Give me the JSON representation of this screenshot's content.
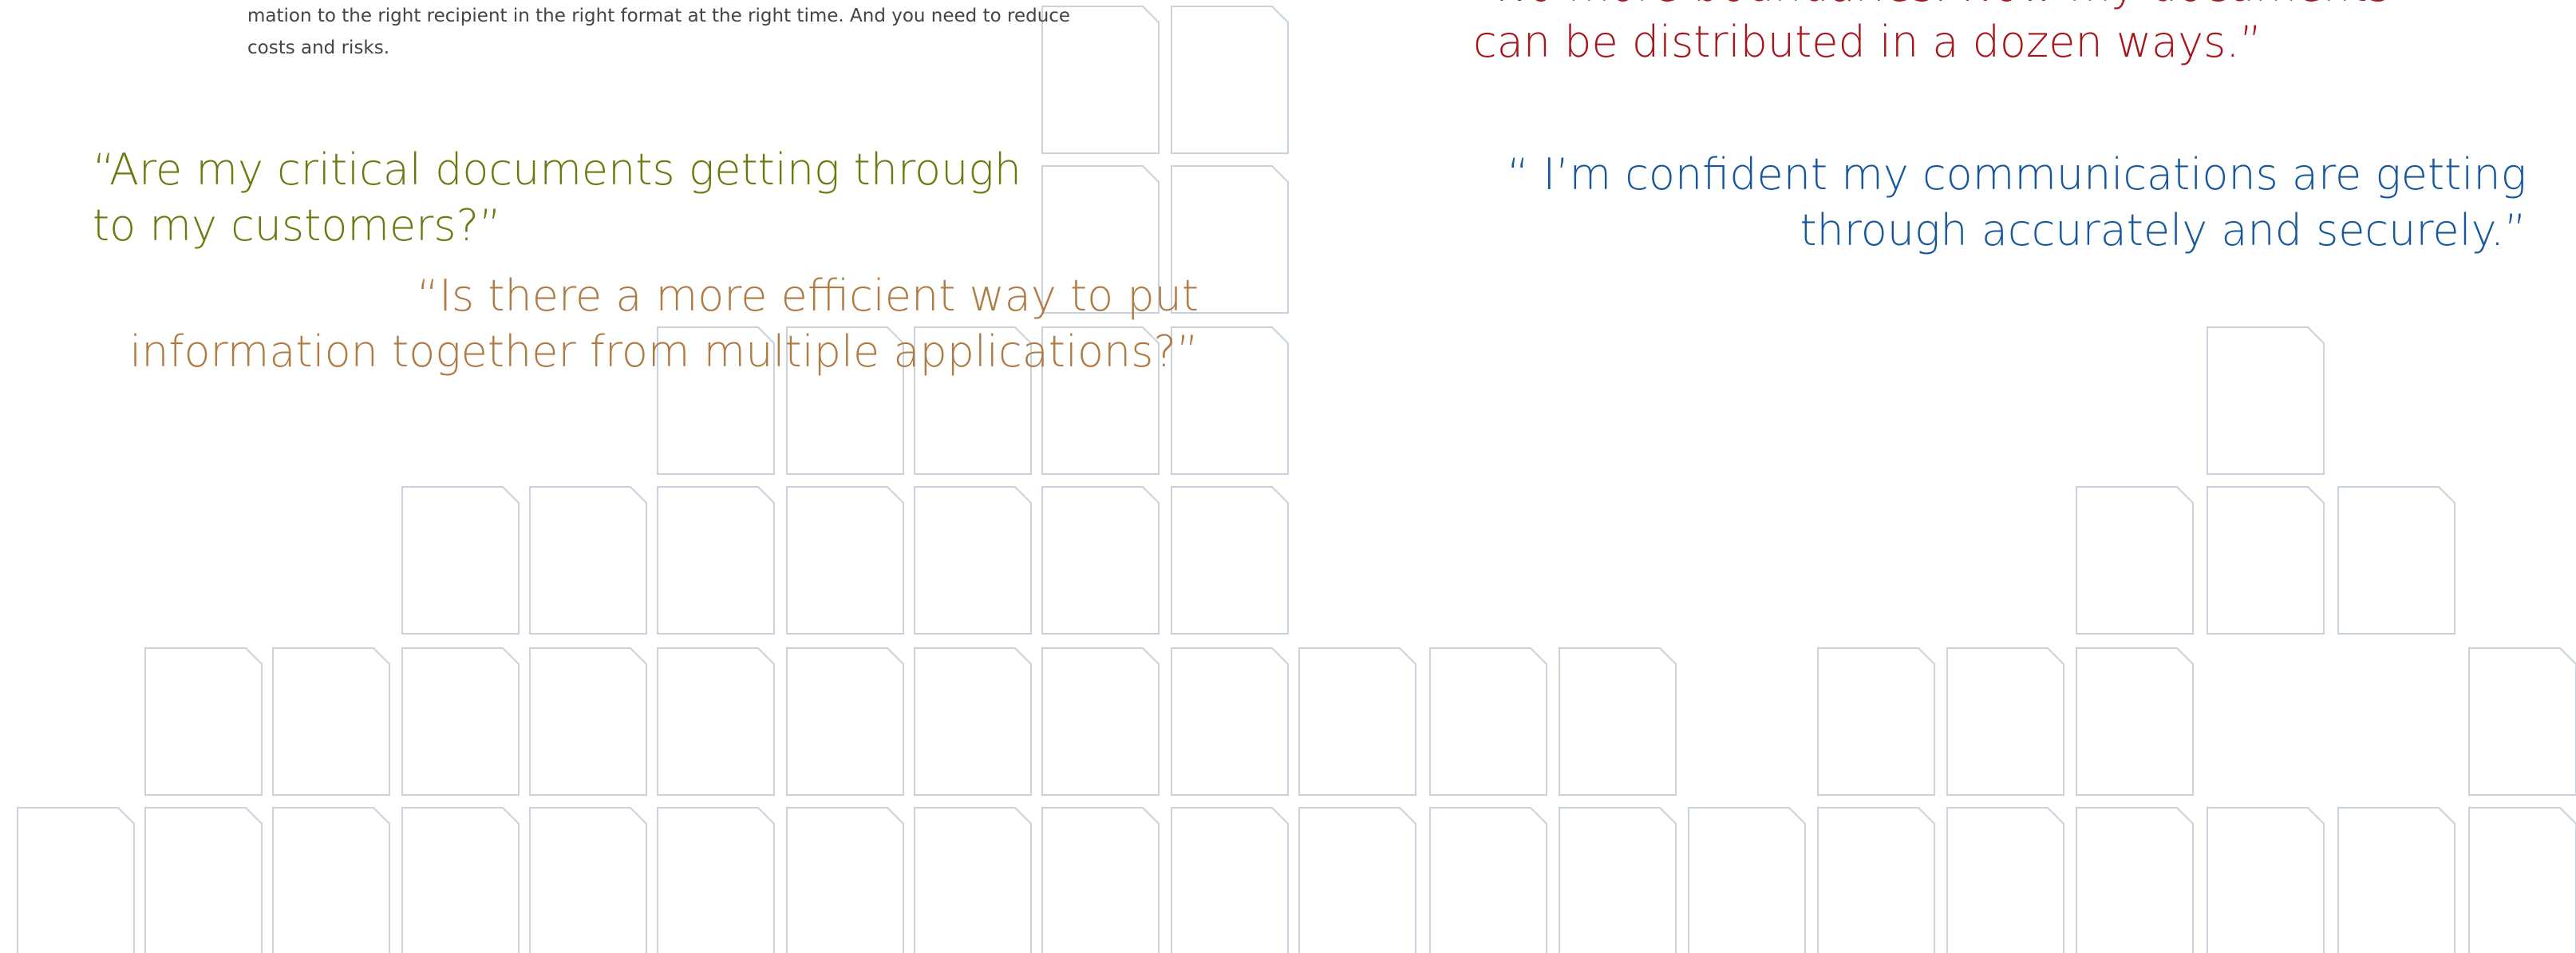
{
  "body_text": {
    "line_1": "mation to the right recipient in the right format at the right time. And you need to reduce",
    "line_2": "costs and risks."
  },
  "quotes": {
    "critical_documents": {
      "line_1": "“Are my critical documents getting through",
      "line_2": "to my customers?”",
      "color": "#6b7a0f"
    },
    "efficient_way": {
      "line_1": "“Is there a more efficient way to put",
      "line_2": "information together from multiple applications?”",
      "color": "#b07a43"
    },
    "no_more_boundaries": {
      "line_1": "“No more boundaries. Now my documents",
      "line_2": "can be distributed in a dozen ways.”",
      "color": "#a8151d"
    },
    "confident": {
      "line_1": "“ I’m confident my communications are getting",
      "line_2": "through accurately and securely.”",
      "color": "#14579e"
    }
  },
  "photo_mosaics": {
    "left_photo": "businesswoman-with-glasses",
    "right_photo": "smiling-man-with-glasses"
  }
}
